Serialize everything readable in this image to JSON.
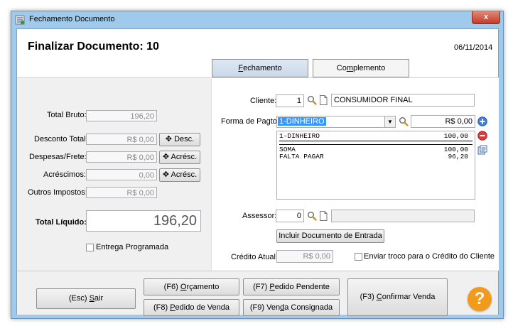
{
  "window": {
    "title": "Fechamento Documento",
    "close_label": "x"
  },
  "header": {
    "title": "Finalizar Documento: 10",
    "date": "06/11/2014"
  },
  "tabs": [
    {
      "label_u": "F",
      "label_rest": "echamento",
      "active": true
    },
    {
      "label_pre": "Co",
      "label_u": "m",
      "label_rest": "plemento",
      "active": false
    }
  ],
  "totals": {
    "total_bruto": {
      "label": "Total Bruto:",
      "value": "196,20"
    },
    "desconto": {
      "label": "Desconto Total:",
      "value": "R$ 0,00",
      "button": "Desc."
    },
    "despesas": {
      "label": "Despesas/Frete:",
      "value": "R$ 0,00",
      "button": "Acrésc."
    },
    "acrescimos": {
      "label": "Acréscimos:",
      "value": "0,00",
      "button": "Acrésc."
    },
    "impostos": {
      "label": "Outros Impostos:",
      "value": "R$ 0,00"
    },
    "liquido": {
      "label": "Total Líquido:",
      "value": "196,20"
    },
    "entrega_label": "Entrega Programada"
  },
  "cliente": {
    "label": "Cliente:",
    "code": "1",
    "name": "CONSUMIDOR FINAL"
  },
  "pagamento": {
    "label": "Forma de Pagto:",
    "selected": "1-DINHEIRO",
    "amount": "R$ 0,00",
    "lines": [
      {
        "desc": "1-DINHEIRO",
        "value": "100,00"
      }
    ],
    "soma": {
      "desc": "SOMA",
      "value": "100,00"
    },
    "falta": {
      "desc": "FALTA PAGAR",
      "value": "96,20"
    }
  },
  "assessor": {
    "label": "Assessor:",
    "code": "0",
    "name": ""
  },
  "incluir_label": "Incluir Documento de Entrada",
  "credito": {
    "label": "Crédito Atual:",
    "value": "R$ 0,00",
    "troco_label": "Enviar troco para o Crédito do Cliente"
  },
  "bottom": {
    "sair": {
      "pre": "(Esc) ",
      "u": "S",
      "rest": "air"
    },
    "orcamento": {
      "pre": "(F6) ",
      "u": "O",
      "rest": "rçamento"
    },
    "pedido_pendente": {
      "pre": "(F7) ",
      "u": "P",
      "rest": "edido Pendente"
    },
    "pedido_venda": {
      "pre": "(F8) ",
      "u": "P",
      "rest": "edido de Venda"
    },
    "venda_consignada": {
      "pre": "(F9) Ven",
      "u": "d",
      "rest": "a Consignada"
    },
    "confirmar": {
      "pre": "(F3) ",
      "u": "C",
      "rest": "onfirmar Venda"
    },
    "help_label": "?"
  },
  "colors": {
    "help": "#f39a1c",
    "add": "#3f7fd6",
    "remove": "#d93c3c",
    "accent": "#3399ff"
  }
}
